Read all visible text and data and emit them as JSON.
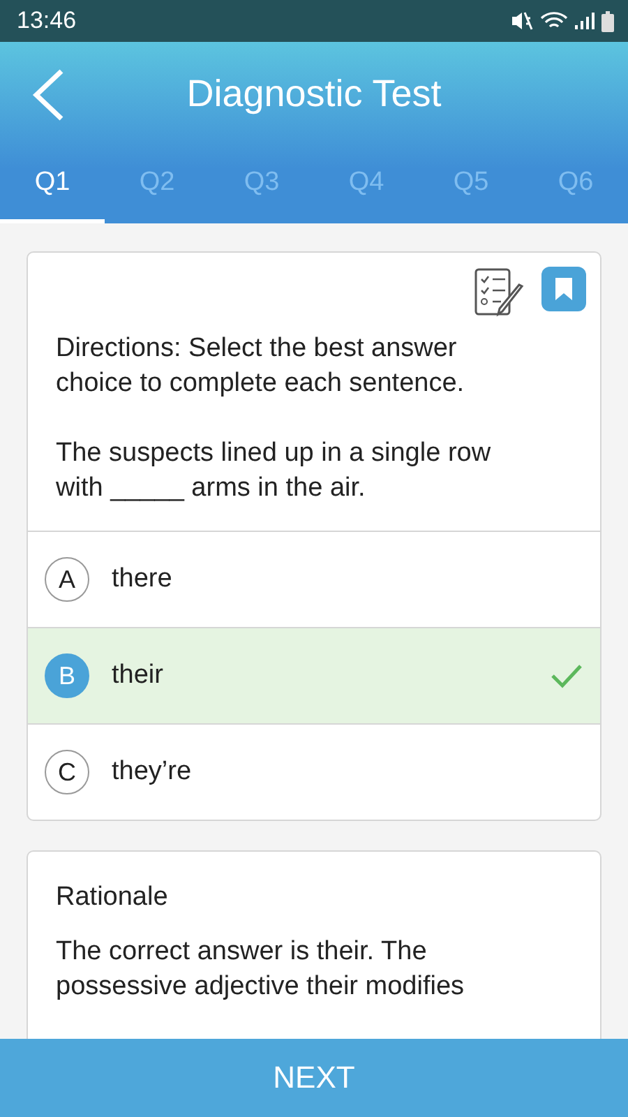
{
  "status_bar": {
    "time": "13:46"
  },
  "header": {
    "title": "Diagnostic Test"
  },
  "tabs": [
    {
      "label": "Q1",
      "selected": true
    },
    {
      "label": "Q2",
      "selected": false
    },
    {
      "label": "Q3",
      "selected": false
    },
    {
      "label": "Q4",
      "selected": false
    },
    {
      "label": "Q5",
      "selected": false
    },
    {
      "label": "Q6",
      "selected": false
    }
  ],
  "question": {
    "bookmarked": true,
    "directions": "Directions: Select the best answer choice to complete each sentence.",
    "prompt": "The suspects lined up in a single row with _____ arms in the air.",
    "options": [
      {
        "letter": "A",
        "text": "there",
        "selected": false,
        "correct": false
      },
      {
        "letter": "B",
        "text": "their",
        "selected": true,
        "correct": true
      },
      {
        "letter": "C",
        "text": "they’re",
        "selected": false,
        "correct": false
      }
    ]
  },
  "rationale": {
    "title": "Rationale",
    "text": "The correct answer is their. The possessive adjective their modifies"
  },
  "next_button": "NEXT"
}
